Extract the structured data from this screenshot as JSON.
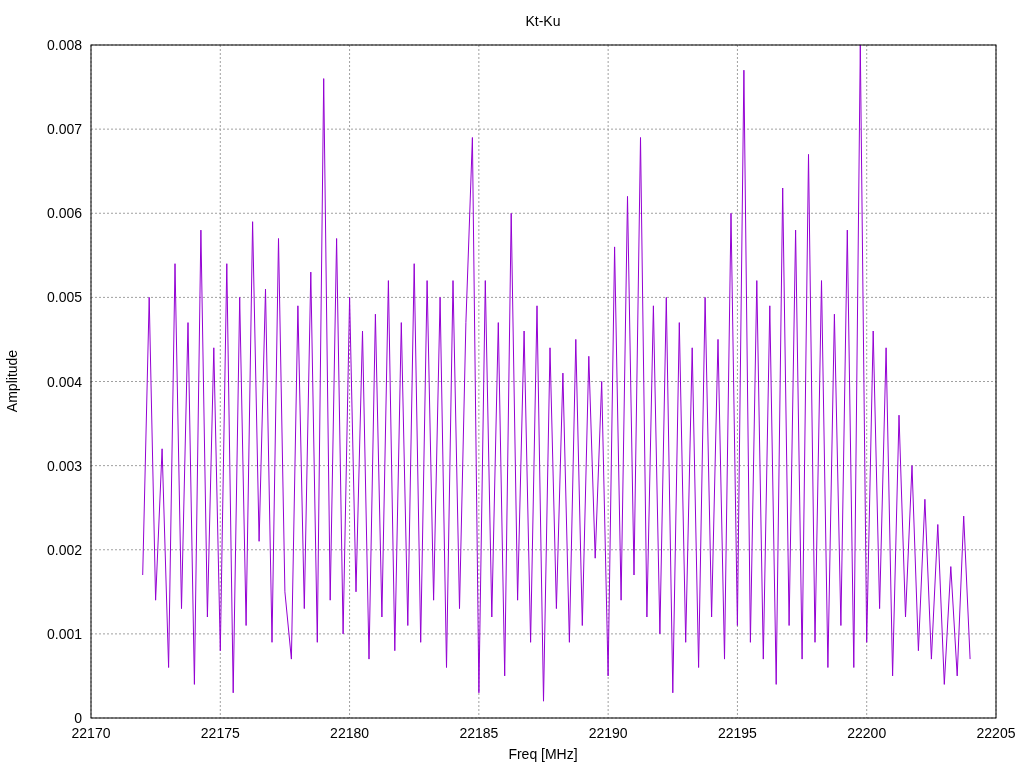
{
  "chart": {
    "chart_data": {
      "type": "line",
      "title": "Kt-Ku",
      "xlabel": "Freq [MHz]",
      "ylabel": "Amplitude",
      "xlim": [
        22170,
        22205
      ],
      "ylim": [
        0,
        0.008
      ],
      "xticks": [
        22170,
        22175,
        22180,
        22185,
        22190,
        22195,
        22200,
        22205
      ],
      "yticks": [
        0,
        0.001,
        0.002,
        0.003,
        0.004,
        0.005,
        0.006,
        0.007,
        0.008
      ],
      "grid": true,
      "x": [
        22172,
        22172.25,
        22172.5,
        22172.75,
        22173,
        22173.25,
        22173.5,
        22173.75,
        22174,
        22174.25,
        22174.5,
        22174.75,
        22175,
        22175.25,
        22175.5,
        22175.75,
        22176,
        22176.25,
        22176.5,
        22176.75,
        22177,
        22177.25,
        22177.5,
        22177.75,
        22178,
        22178.25,
        22178.5,
        22178.75,
        22179,
        22179.25,
        22179.5,
        22179.75,
        22180,
        22180.25,
        22180.5,
        22180.75,
        22181,
        22181.25,
        22181.5,
        22181.75,
        22182,
        22182.25,
        22182.5,
        22182.75,
        22183,
        22183.25,
        22183.5,
        22183.75,
        22184,
        22184.25,
        22184.5,
        22184.75,
        22185,
        22185.25,
        22185.5,
        22185.75,
        22186,
        22186.25,
        22186.5,
        22186.75,
        22187,
        22187.25,
        22187.5,
        22187.75,
        22188,
        22188.25,
        22188.5,
        22188.75,
        22189,
        22189.25,
        22189.5,
        22189.75,
        22190,
        22190.25,
        22190.5,
        22190.75,
        22191,
        22191.25,
        22191.5,
        22191.75,
        22192,
        22192.25,
        22192.5,
        22192.75,
        22193,
        22193.25,
        22193.5,
        22193.75,
        22194,
        22194.25,
        22194.5,
        22194.75,
        22195,
        22195.25,
        22195.5,
        22195.75,
        22196,
        22196.25,
        22196.5,
        22196.75,
        22197,
        22197.25,
        22197.5,
        22197.75,
        22198,
        22198.25,
        22198.5,
        22198.75,
        22199,
        22199.25,
        22199.5,
        22199.75,
        22200,
        22200.25,
        22200.5,
        22200.75,
        22201,
        22201.25,
        22201.5,
        22201.75,
        22202,
        22202.25,
        22202.5,
        22202.75,
        22203,
        22203.25,
        22203.5,
        22203.75,
        22204
      ],
      "series": [
        {
          "color": "#9400d3",
          "values": [
            0.0017,
            0.005,
            0.0014,
            0.0032,
            0.0006,
            0.0054,
            0.0013,
            0.0047,
            0.0004,
            0.0058,
            0.0012,
            0.0044,
            0.0008,
            0.0054,
            0.0003,
            0.005,
            0.0011,
            0.0059,
            0.0021,
            0.0051,
            0.0009,
            0.0057,
            0.0015,
            0.0007,
            0.0049,
            0.0013,
            0.0053,
            0.0009,
            0.0076,
            0.0014,
            0.0057,
            0.001,
            0.005,
            0.0015,
            0.0046,
            0.0007,
            0.0048,
            0.0012,
            0.0052,
            0.0008,
            0.0047,
            0.0011,
            0.0054,
            0.0009,
            0.0052,
            0.0014,
            0.005,
            0.0006,
            0.0052,
            0.0013,
            0.0047,
            0.0069,
            0.0003,
            0.0052,
            0.0012,
            0.0047,
            0.0005,
            0.006,
            0.0014,
            0.0046,
            0.0009,
            0.0049,
            0.0002,
            0.0044,
            0.0013,
            0.0041,
            0.0009,
            0.0045,
            0.0011,
            0.0043,
            0.0019,
            0.004,
            0.0005,
            0.0056,
            0.0014,
            0.0062,
            0.0017,
            0.0069,
            0.0012,
            0.0049,
            0.001,
            0.005,
            0.0003,
            0.0047,
            0.0009,
            0.0044,
            0.0006,
            0.005,
            0.0012,
            0.0045,
            0.0007,
            0.006,
            0.0011,
            0.0077,
            0.0009,
            0.0052,
            0.0007,
            0.0049,
            0.0004,
            0.0063,
            0.0011,
            0.0058,
            0.0007,
            0.0067,
            0.0009,
            0.0052,
            0.0006,
            0.0048,
            0.0011,
            0.0058,
            0.0006,
            0.008,
            0.0009,
            0.0046,
            0.0013,
            0.0044,
            0.0005,
            0.0036,
            0.0012,
            0.003,
            0.0008,
            0.0026,
            0.0007,
            0.0023,
            0.0004,
            0.0018,
            0.0005,
            0.0024,
            0.0007
          ]
        }
      ]
    }
  }
}
